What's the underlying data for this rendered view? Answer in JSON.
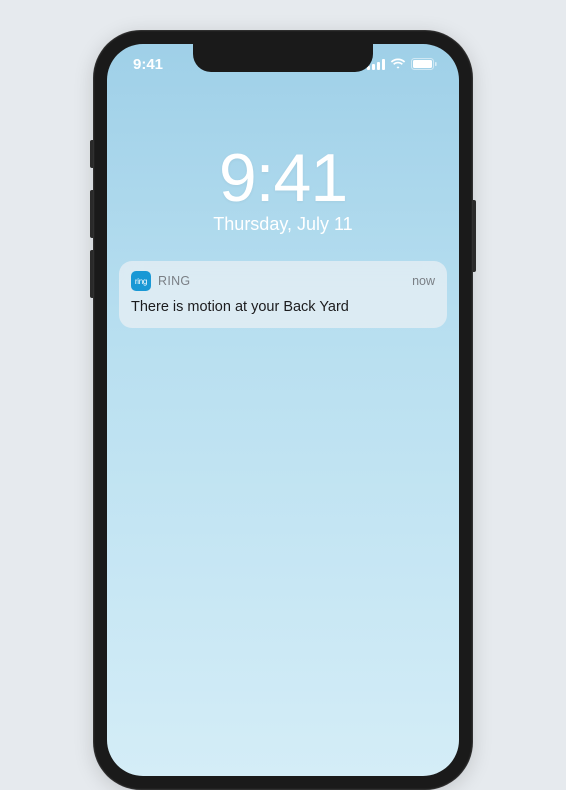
{
  "status_bar": {
    "time": "9:41"
  },
  "lock_screen": {
    "time": "9:41",
    "date": "Thursday, July 11"
  },
  "notification": {
    "app_icon_text": "ring",
    "app_name": "RING",
    "time": "now",
    "message": "There is motion at your Back Yard"
  }
}
